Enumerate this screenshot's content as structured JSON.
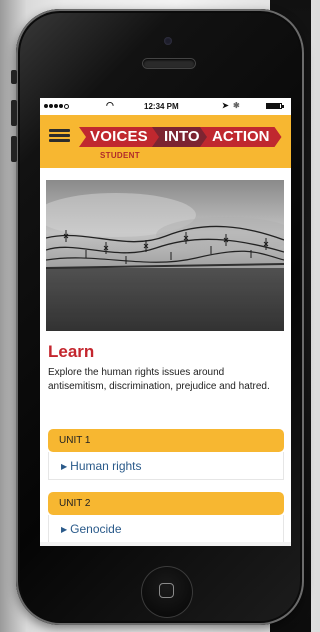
{
  "status_bar": {
    "signal_icon": "signal-dots-icon",
    "wifi_icon": "wifi-icon",
    "time": "12:34 PM",
    "location_icon": "location-arrow-icon",
    "bluetooth_icon": "bluetooth-icon",
    "battery_icon": "battery-icon",
    "battery_level": 0.95
  },
  "header": {
    "menu_icon": "hamburger-menu-icon",
    "brand": {
      "part1": "VOICES",
      "part2": "INTO",
      "part3": "ACTION"
    },
    "subtitle": "STUDENT",
    "colors": {
      "header_bg": "#f7b731",
      "brand_red": "#c0282f",
      "brand_maroon": "#7c2431"
    }
  },
  "hero": {
    "image_icon": "barbed-wire-photo"
  },
  "learn": {
    "title": "Learn",
    "description": "Explore the human rights issues around antisemitism, discrimination, prejudice and hatred."
  },
  "units": [
    {
      "heading": "UNIT 1",
      "link": "Human rights"
    },
    {
      "heading": "UNIT 2",
      "link": "Genocide"
    }
  ]
}
